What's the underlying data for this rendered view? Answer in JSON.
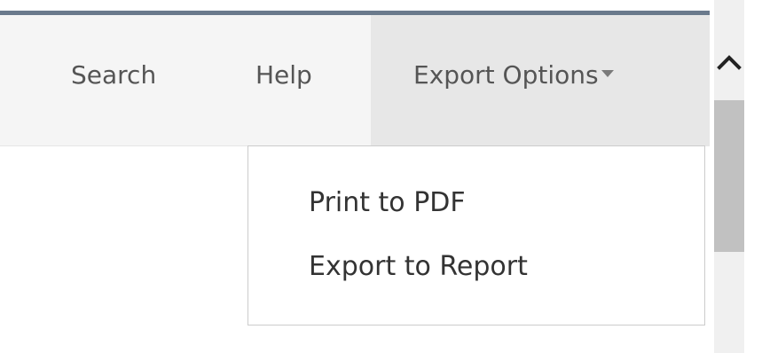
{
  "navbar": {
    "search_label": "Search",
    "help_label": "Help",
    "export_label": "Export Options"
  },
  "dropdown": {
    "items": [
      {
        "label": "Print to PDF"
      },
      {
        "label": "Export to Report"
      }
    ]
  },
  "scrollbar": {
    "up_icon": "chevron-up-icon"
  },
  "colors": {
    "top_rule": "#6a7a8c",
    "navbar_bg": "#f5f5f5",
    "active_nav_bg": "#e7e7e7",
    "nav_text": "#555555",
    "menu_text": "#333333",
    "scroll_thumb": "#c1c1c1"
  }
}
